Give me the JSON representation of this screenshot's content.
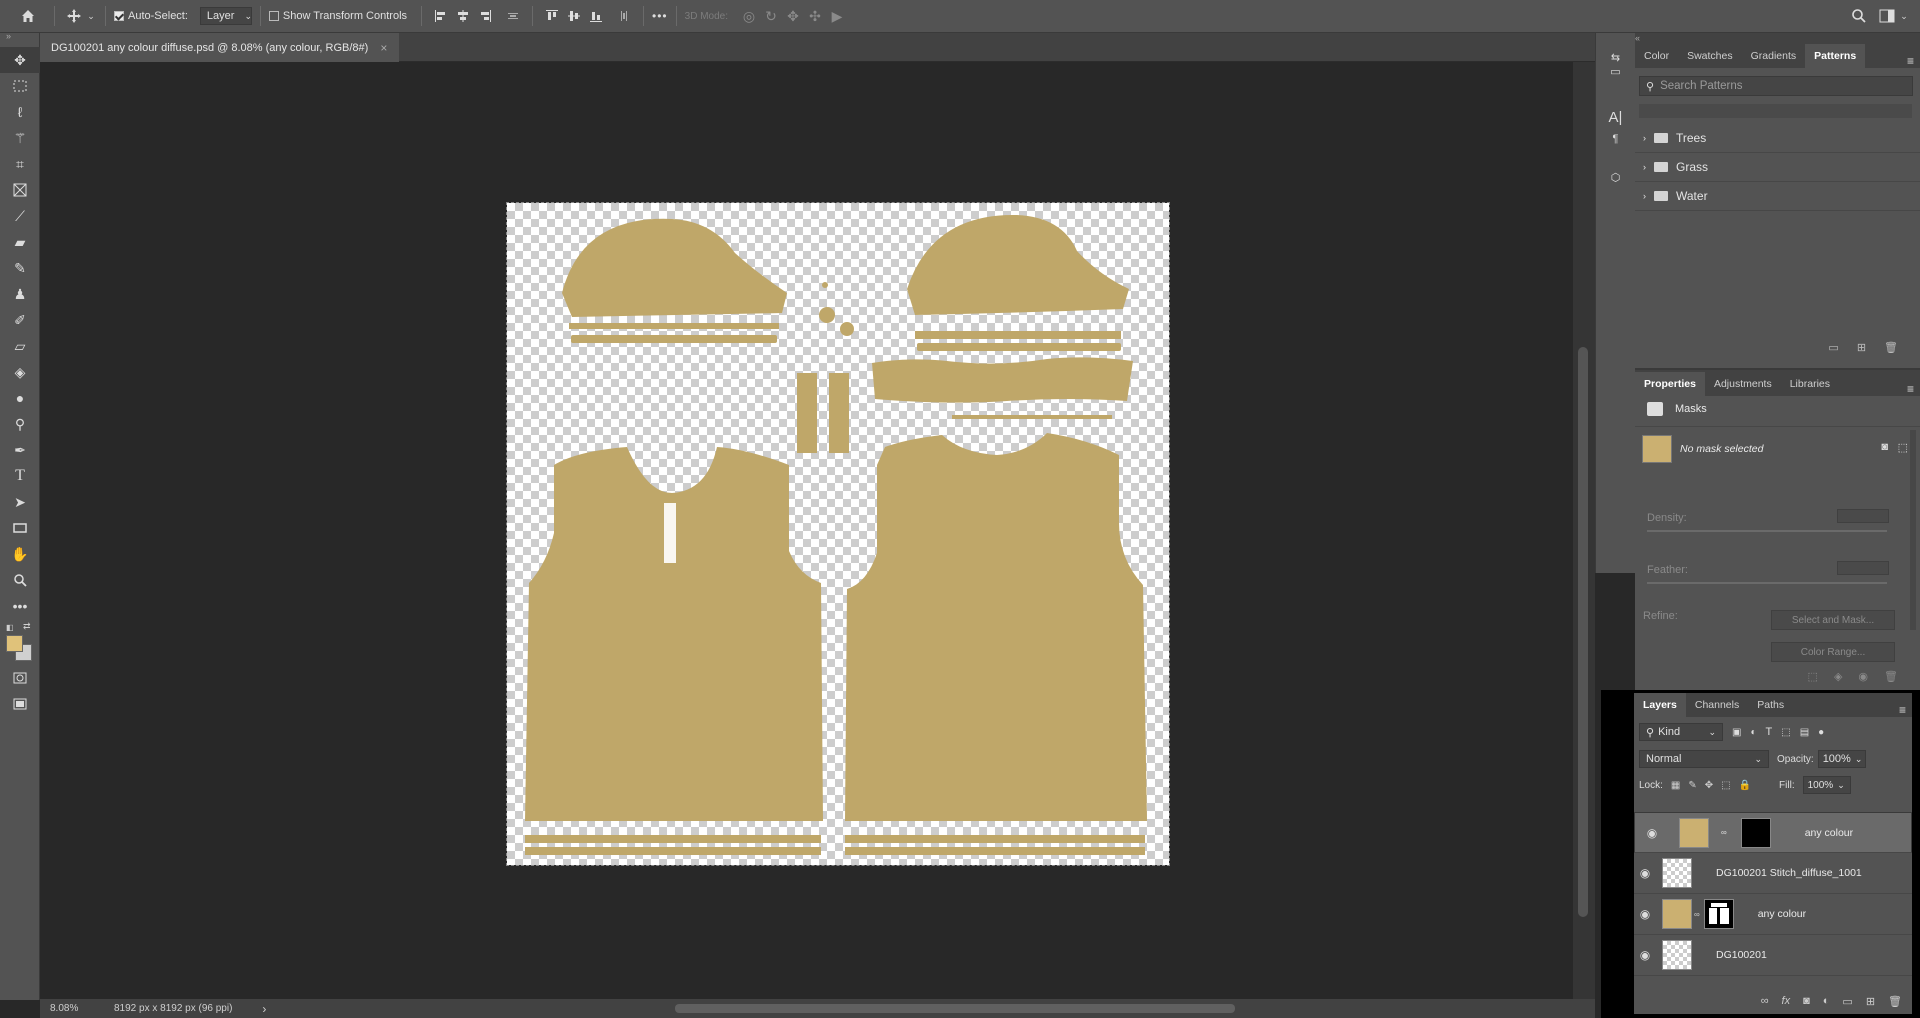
{
  "options_bar": {
    "auto_select_label": "Auto-Select:",
    "auto_select_checked": true,
    "layer_select": "Layer",
    "show_transform_label": "Show Transform Controls",
    "mode_3d_label": "3D Mode:",
    "more_label": "•••"
  },
  "document": {
    "tab_title": "DG100201 any colour diffuse.psd @ 8.08% (any colour, RGB/8#)",
    "close_glyph": "×",
    "shape_color": "#bfa769"
  },
  "status": {
    "zoom": "8.08%",
    "dimensions": "8192 px x 8192 px (96 ppi)",
    "arrow": "›"
  },
  "patterns_panel": {
    "tabs": [
      "Color",
      "Swatches",
      "Gradients",
      "Patterns"
    ],
    "active_tab": "Patterns",
    "search_placeholder": "Search Patterns",
    "folders": [
      "Trees",
      "Grass",
      "Water"
    ]
  },
  "properties_panel": {
    "tabs": [
      "Properties",
      "Adjustments",
      "Libraries"
    ],
    "section": "Masks",
    "mask_state": "No mask selected",
    "density_label": "Density:",
    "feather_label": "Feather:",
    "refine_label": "Refine:",
    "select_mask_button": "Select and Mask...",
    "color_range_button": "Color Range..."
  },
  "layers_panel": {
    "tabs": [
      "Layers",
      "Channels",
      "Paths"
    ],
    "filter_kind": "Kind",
    "blend_mode": "Normal",
    "opacity_label": "Opacity:",
    "opacity_value": "100%",
    "lock_label": "Lock:",
    "fill_label": "Fill:",
    "fill_value": "100%",
    "layers": [
      {
        "name": "any colour",
        "thumb": "color",
        "mask": "black",
        "selected": true
      },
      {
        "name": "DG100201 Stitch_diffuse_1001",
        "thumb": "transparent",
        "mask": null,
        "selected": false
      },
      {
        "name": "any colour",
        "thumb": "color",
        "mask": "shapes",
        "selected": false
      },
      {
        "name": "DG100201",
        "thumb": "transparent",
        "mask": null,
        "selected": false
      }
    ]
  },
  "colors": {
    "foreground": "#e0c27a",
    "background": "#d0d0d0",
    "accent_selected_layer": "#6a6a6a"
  }
}
